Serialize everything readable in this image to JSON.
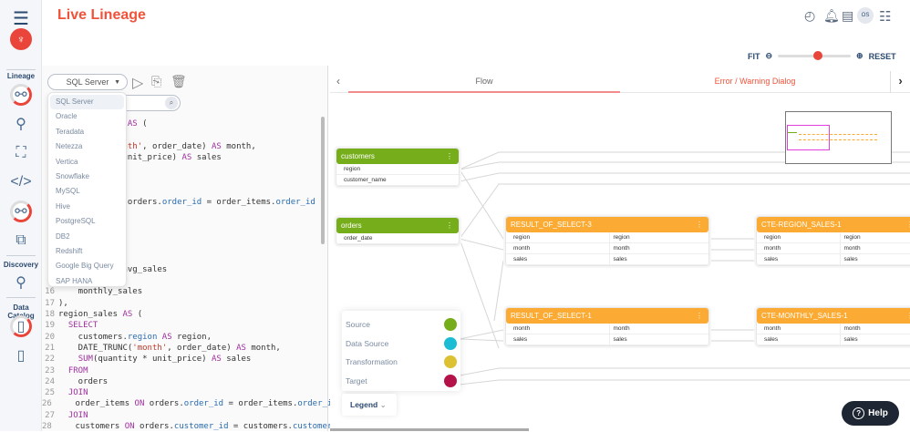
{
  "header": {
    "title": "Live Lineage",
    "avatar": "OS"
  },
  "sidebar": {
    "sections": [
      "Lineage",
      "Discovery",
      "Data Catalog"
    ]
  },
  "zoom": {
    "fit": "FIT",
    "reset": "RESET",
    "level": 0.55
  },
  "editor": {
    "db_selected": "SQL Server",
    "db_options": [
      "SQL Server",
      "Oracle",
      "Teradata",
      "Netezza",
      "Vertica",
      "Snowflake",
      "MySQL",
      "Hive",
      "PostgreSQL",
      "DB2",
      "Redshift",
      "Google Big Query",
      "SAP HANA"
    ],
    "hidden_lines": [
      {
        "n": "",
        "t": "           es AS ("
      },
      {
        "n": "",
        "t": ""
      },
      {
        "n": "",
        "t": "           month', order_date) AS month,"
      },
      {
        "n": "",
        "t": "           * unit_price) AS sales"
      },
      {
        "n": "",
        "t": ""
      },
      {
        "n": "",
        "t": ""
      },
      {
        "n": "",
        "t": ""
      },
      {
        "n": "",
        "t": "           ON orders.order_id = order_items.order_id"
      },
      {
        "n": "",
        "t": ""
      },
      {
        "n": "",
        "t": ""
      },
      {
        "n": "",
        "t": ""
      },
      {
        "n": "",
        "t": "           ("
      },
      {
        "n": "",
        "t": ""
      },
      {
        "n": "",
        "t": "           S avg_sales"
      },
      {
        "n": "",
        "t": ""
      }
    ],
    "lines": [
      {
        "n": "16",
        "t": "    monthly_sales"
      },
      {
        "n": "17",
        "t": "),"
      },
      {
        "n": "18",
        "t": "region_sales AS ("
      },
      {
        "n": "19",
        "t": "  SELECT"
      },
      {
        "n": "20",
        "t": "    customers.region AS region,"
      },
      {
        "n": "21",
        "t": "    DATE_TRUNC('month', order_date) AS month,"
      },
      {
        "n": "22",
        "t": "    SUM(quantity * unit_price) AS sales"
      },
      {
        "n": "23",
        "t": "  FROM"
      },
      {
        "n": "24",
        "t": "    orders"
      },
      {
        "n": "25",
        "t": "  JOIN"
      },
      {
        "n": "26",
        "t": "    order_items ON orders.order_id = order_items.order_id"
      },
      {
        "n": "27",
        "t": "  JOIN"
      },
      {
        "n": "28",
        "t": "    customers ON orders.customer_id = customers.customer_id"
      }
    ]
  },
  "tabs": [
    {
      "label": "Flow",
      "active": true
    },
    {
      "label": "Error / Warning Dialog",
      "active": false
    }
  ],
  "nodes": {
    "customers": {
      "title": "customers",
      "rows": [
        "region",
        "customer_name"
      ]
    },
    "orders": {
      "title": "orders",
      "rows": [
        "order_date"
      ]
    },
    "rs3": {
      "title": "RESULT_OF_SELECT-3",
      "rows": [
        [
          "region",
          "region"
        ],
        [
          "month",
          "month"
        ],
        [
          "sales",
          "sales"
        ]
      ]
    },
    "crs": {
      "title": "CTE-REGION_SALES-1",
      "rows": [
        [
          "region",
          "region"
        ],
        [
          "month",
          "month"
        ],
        [
          "sales",
          "sales"
        ]
      ]
    },
    "rs1": {
      "title": "RESULT_OF_SELECT-1",
      "rows": [
        [
          "month",
          "month"
        ],
        [
          "sales",
          "sales"
        ]
      ]
    },
    "cms": {
      "title": "CTE-MONTHLY_SALES-1",
      "rows": [
        [
          "month",
          "month"
        ],
        [
          "sales",
          "sales"
        ]
      ]
    }
  },
  "legend": {
    "button": "Legend",
    "items": [
      {
        "label": "Source",
        "color": "#76ad1a"
      },
      {
        "label": "Data Source",
        "color": "#1bbcd4"
      },
      {
        "label": "Transformation",
        "color": "#dcc232"
      },
      {
        "label": "Target",
        "color": "#b5124a"
      }
    ]
  },
  "colors": {
    "source": "#76ad1a",
    "transformation": "#fbab33",
    "accent": "#f0533a"
  },
  "help": {
    "label": "Help"
  }
}
